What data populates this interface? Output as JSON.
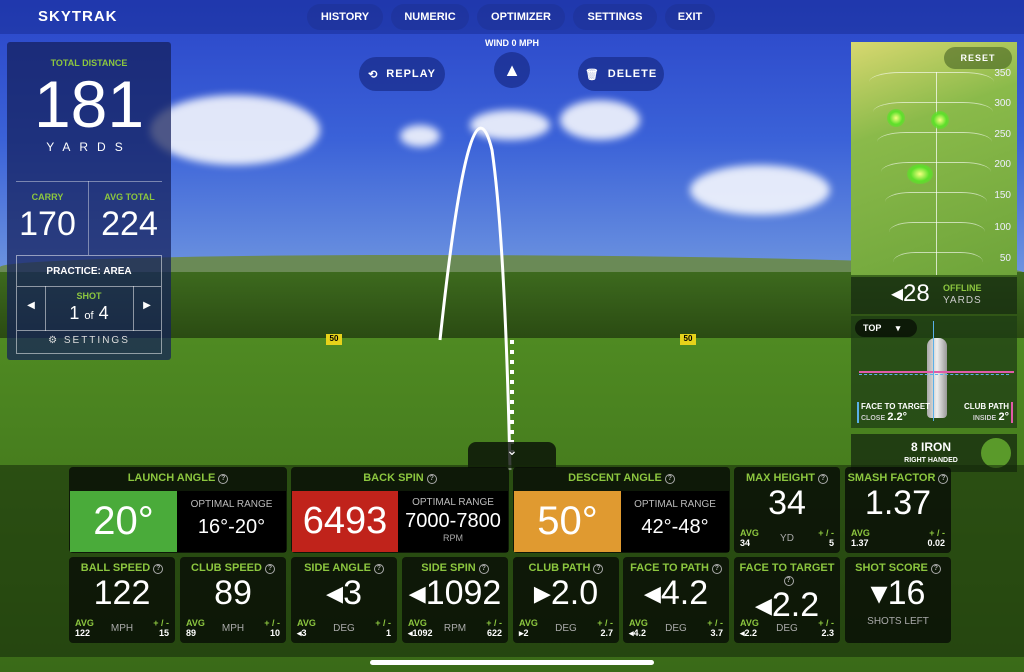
{
  "brand": "SKYTRAK",
  "nav": [
    "HISTORY",
    "NUMERIC",
    "OPTIMIZER",
    "SETTINGS",
    "EXIT"
  ],
  "wind": "WIND 0 MPH",
  "replay": "REPLAY",
  "delete": "DELETE",
  "left": {
    "title": "TOTAL DISTANCE",
    "total": "181",
    "unit": "YARDS",
    "carry_label": "CARRY",
    "carry": "170",
    "avg_label": "AVG TOTAL",
    "avg": "224",
    "mode": "PRACTICE: AREA",
    "shot_label": "SHOT",
    "shot": "1",
    "of": "of",
    "shots": "4",
    "settings": "SETTINGS"
  },
  "map": {
    "reset": "RESET",
    "ticks": [
      "350",
      "300",
      "250",
      "200",
      "150",
      "100",
      "50"
    ]
  },
  "offline": {
    "value": "28",
    "label": "OFFLINE",
    "unit": "YARDS"
  },
  "club_view": {
    "view": "TOP",
    "ftt_label": "FACE TO TARGET",
    "ftt_dir": "CLOSE",
    "ftt": "2.2°",
    "cp_label": "CLUB PATH",
    "cp_dir": "INSIDE",
    "cp": "2°"
  },
  "club": {
    "name": "8 IRON",
    "hand": "RIGHT HANDED"
  },
  "range_markers": [
    "50",
    "50"
  ],
  "optimal_label": "OPTIMAL RANGE",
  "launch": {
    "title": "LAUNCH ANGLE",
    "value": "20°",
    "range": "16°-20°",
    "color": "#4aab3a"
  },
  "backspin": {
    "title": "BACK SPIN",
    "value": "6493",
    "range": "7000-7800",
    "unit": "RPM",
    "color": "#c0231b"
  },
  "descent": {
    "title": "DESCENT ANGLE",
    "value": "50°",
    "range": "42°-48°",
    "color": "#e09a30"
  },
  "avg": "AVG",
  "pm": "+ / -",
  "tiles": [
    {
      "title": "MAX HEIGHT",
      "value": "34",
      "avg": "34",
      "unit": "YD",
      "pm": "5"
    },
    {
      "title": "SMASH FACTOR",
      "value": "1.37",
      "avg": "1.37",
      "unit": "",
      "pm": "0.02"
    },
    {
      "title": "BALL SPEED",
      "value": "122",
      "avg": "122",
      "unit": "MPH",
      "pm": "15"
    },
    {
      "title": "CLUB SPEED",
      "value": "89",
      "avg": "89",
      "unit": "MPH",
      "pm": "10"
    },
    {
      "title": "SIDE ANGLE",
      "value": "◂3",
      "avg": "◂3",
      "unit": "DEG",
      "pm": "1"
    },
    {
      "title": "SIDE SPIN",
      "value": "◂1092",
      "avg": "◂1092",
      "unit": "RPM",
      "pm": "622"
    },
    {
      "title": "CLUB PATH",
      "value": "▸2.0",
      "avg": "▸2",
      "unit": "DEG",
      "pm": "2.7"
    },
    {
      "title": "FACE TO PATH",
      "value": "◂4.2",
      "avg": "◂4.2",
      "unit": "DEG",
      "pm": "3.7"
    },
    {
      "title": "FACE TO TARGET",
      "value": "◂2.2",
      "avg": "◂2.2",
      "unit": "DEG",
      "pm": "2.3"
    }
  ],
  "score": {
    "title": "SHOT SCORE",
    "value": "▾16",
    "sub": "SHOTS LEFT"
  }
}
